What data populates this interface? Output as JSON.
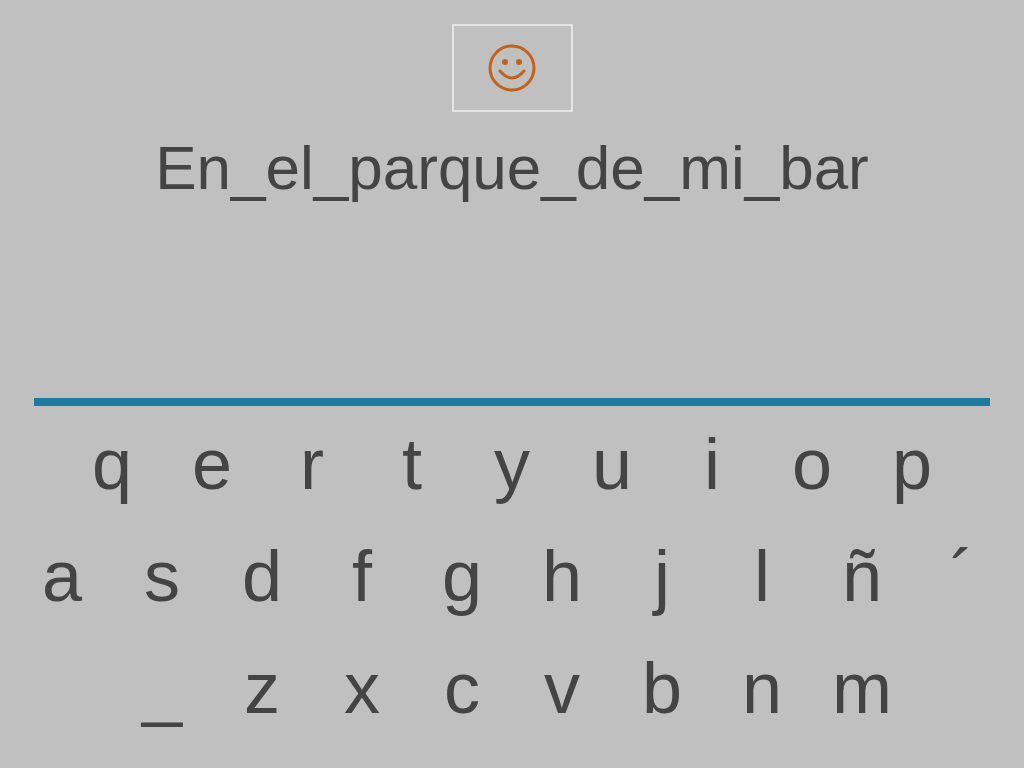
{
  "sentence": "En_el_parque_de_mi_bar",
  "keyboard": {
    "rows": [
      [
        "q",
        "e",
        "r",
        "t",
        "y",
        "u",
        "i",
        "o",
        "p"
      ],
      [
        "a",
        "s",
        "d",
        "f",
        "g",
        "h",
        "j",
        "l",
        "ñ",
        "´"
      ],
      [
        "_",
        "z",
        "x",
        "c",
        "v",
        "b",
        "n",
        "m"
      ]
    ]
  }
}
